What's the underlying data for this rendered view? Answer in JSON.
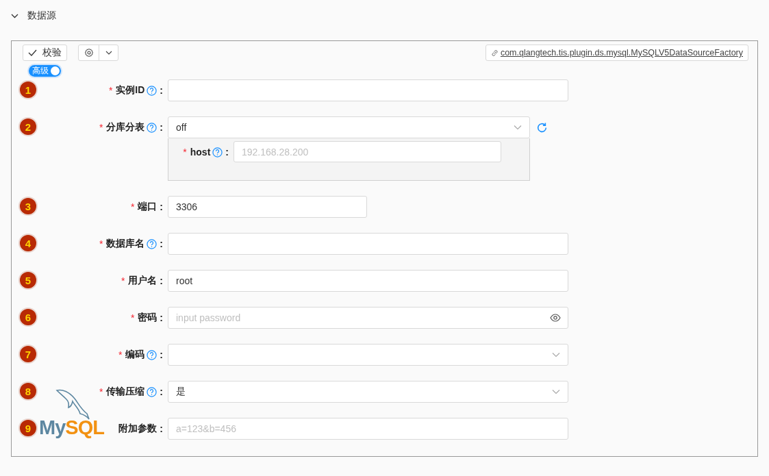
{
  "section": {
    "title": "数据源",
    "expanded": true
  },
  "toolbar": {
    "validate_label": "校验",
    "plugin_link": "com.qlangtech.tis.plugin.ds.mysql.MySQLV5DataSourceFactory"
  },
  "advanced_toggle": {
    "label": "高级",
    "on": true
  },
  "fields": [
    {
      "number": "1",
      "required_mark": "*",
      "label": "实例ID",
      "help": true,
      "colon": ":",
      "kind": "text"
    },
    {
      "number": "2",
      "required_mark": "*",
      "label": "分库分表",
      "help": true,
      "colon": ":",
      "kind": "select",
      "value": "off",
      "refresh": true,
      "sub_fields": [
        {
          "required_mark": "*",
          "label": "host",
          "help": true,
          "colon": ":",
          "kind": "text",
          "placeholder": "192.168.28.200"
        }
      ]
    },
    {
      "number": "3",
      "required_mark": "*",
      "label": "端口",
      "help": false,
      "colon": ":",
      "kind": "short",
      "value": "3306"
    },
    {
      "number": "4",
      "required_mark": "*",
      "label": "数据库名",
      "help": true,
      "colon": ":",
      "kind": "text"
    },
    {
      "number": "5",
      "required_mark": "*",
      "label": "用户名",
      "help": false,
      "colon": ":",
      "kind": "text",
      "value": "root"
    },
    {
      "number": "6",
      "required_mark": "*",
      "label": "密码",
      "help": false,
      "colon": ":",
      "kind": "password",
      "placeholder": "input password"
    },
    {
      "number": "7",
      "required_mark": "*",
      "label": "编码",
      "help": true,
      "colon": ":",
      "kind": "select"
    },
    {
      "number": "8",
      "required_mark": "*",
      "label": "传输压缩",
      "help": true,
      "colon": ":",
      "kind": "select",
      "value": "是"
    },
    {
      "number": "9",
      "label": "附加参数",
      "help": false,
      "colon": ":",
      "kind": "text",
      "placeholder": "a=123&b=456"
    }
  ],
  "logo_parts": [
    {
      "text": "My",
      "color": "#5d87a1"
    },
    {
      "text": "SQL",
      "color": "#f29111"
    }
  ]
}
